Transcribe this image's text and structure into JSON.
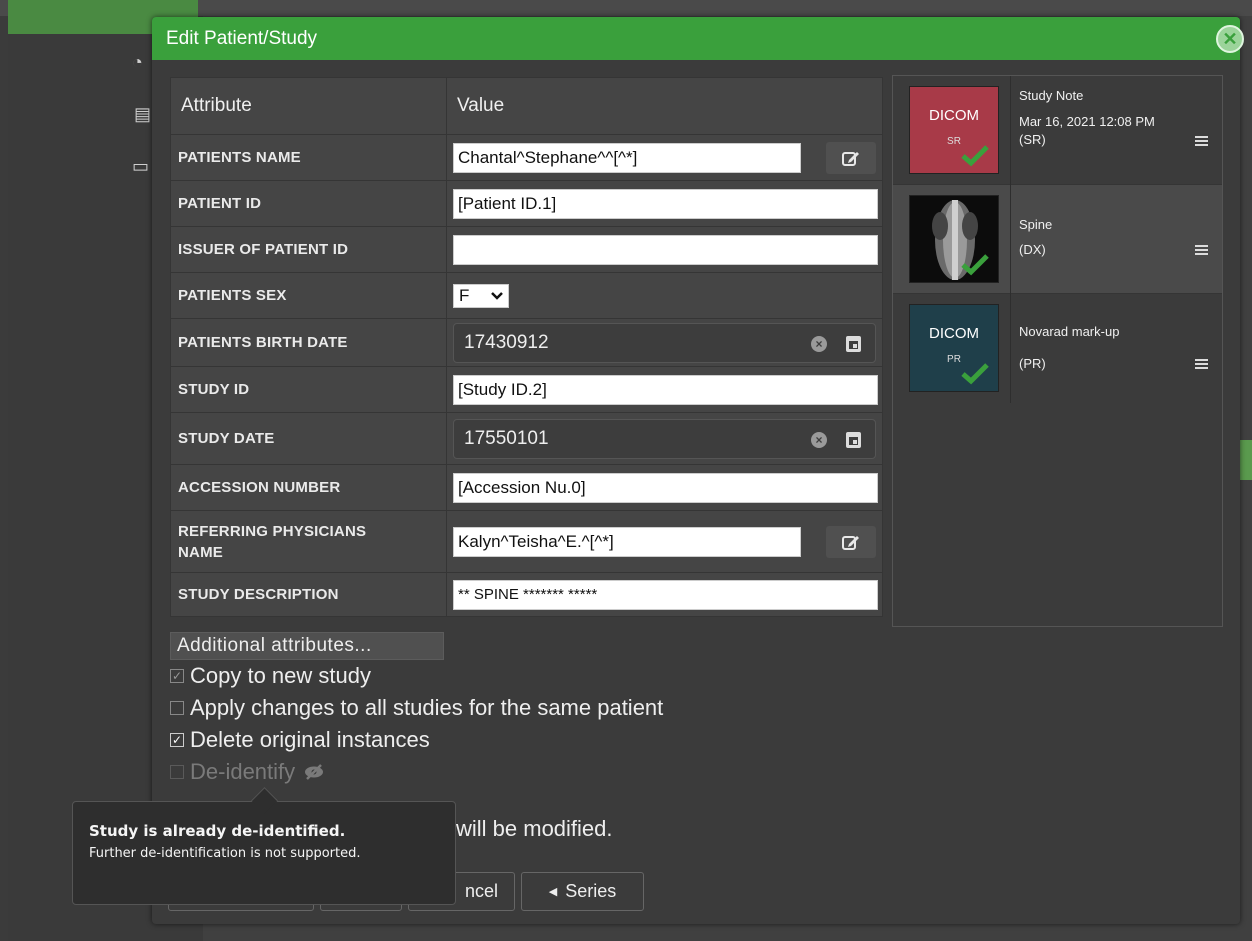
{
  "dialog": {
    "title": "Edit Patient/Study"
  },
  "table": {
    "headers": {
      "attribute": "Attribute",
      "value": "Value"
    },
    "rows": [
      {
        "label": "PATIENTS NAME",
        "value": "Chantal^Stephane^^[^*]"
      },
      {
        "label": "PATIENT ID",
        "value": "[Patient ID.1]"
      },
      {
        "label": "ISSUER OF PATIENT ID",
        "value": ""
      },
      {
        "label": "PATIENTS SEX",
        "value": "F"
      },
      {
        "label": "PATIENTS BIRTH DATE",
        "value": "17430912"
      },
      {
        "label": "STUDY ID",
        "value": "[Study ID.2]"
      },
      {
        "label": "STUDY DATE",
        "value": "17550101"
      },
      {
        "label": "ACCESSION NUMBER",
        "value": "[Accession Nu.0]"
      },
      {
        "label": "REFERRING PHYSICIANS NAME",
        "value": "Kalyn^Teisha^E.^[^*]"
      },
      {
        "label": "STUDY DESCRIPTION",
        "value": "** SPINE ******* *****"
      }
    ]
  },
  "series": [
    {
      "name": "Study Note",
      "date": "Mar 16, 2021 12:08 PM",
      "modality": "(SR)",
      "thumb_text": "DICOM",
      "thumb_mod": "SR",
      "color": "#a83a48"
    },
    {
      "name": "Spine",
      "date": "",
      "modality": "(DX)",
      "thumb_text": "",
      "thumb_mod": "",
      "color": "#111111"
    },
    {
      "name": "Novarad mark-up",
      "date": "",
      "modality": "(PR)",
      "thumb_text": "DICOM",
      "thumb_mod": "PR",
      "color": "#1f3f4a"
    }
  ],
  "options": {
    "additional_label": "Additional attributes...",
    "copy_label": "Copy to new study",
    "copy_checked": true,
    "apply_label": "Apply changes to all studies for the same patient",
    "apply_checked": false,
    "delete_label": "Delete original instances",
    "delete_checked": true,
    "deidentify_label": "De-identify",
    "deidentify_checked": false
  },
  "footer": {
    "modified_text": "will be modified.",
    "cancel_label": "ncel",
    "series_label": "Series"
  },
  "tooltip": {
    "title": "Study is already de-identified.",
    "body": "Further de-identification is not supported."
  },
  "colors": {
    "title_bar": "#3aa03c",
    "check": "#3aa03c"
  }
}
